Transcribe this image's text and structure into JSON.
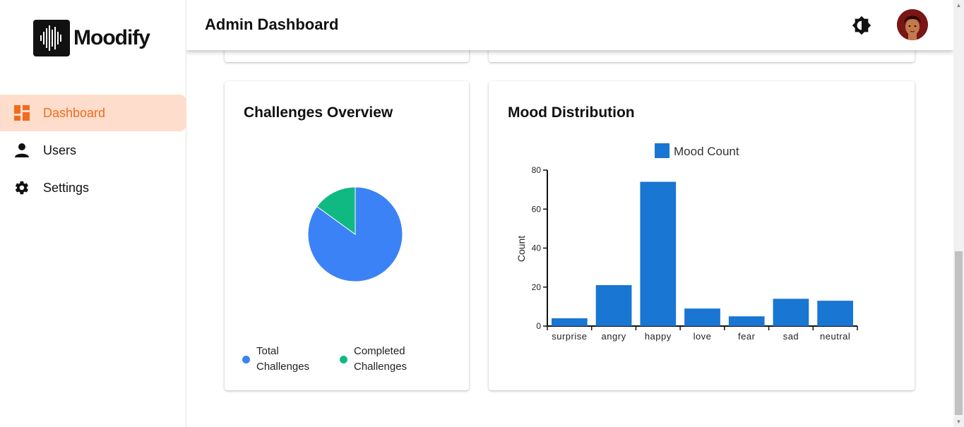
{
  "app": {
    "name": "Moodify"
  },
  "sidebar": {
    "items": [
      {
        "label": "Dashboard",
        "icon": "dashboard-icon",
        "active": true
      },
      {
        "label": "Users",
        "icon": "person-icon",
        "active": false
      },
      {
        "label": "Settings",
        "icon": "gear-icon",
        "active": false
      }
    ]
  },
  "header": {
    "title": "Admin Dashboard",
    "theme_icon": "brightness-icon",
    "avatar_icon": "user-avatar"
  },
  "colors": {
    "accent": "#f26b1d",
    "active_bg": "#ffddcc",
    "blue": "#3b82f6",
    "green": "#10b981",
    "bar": "#1976d2"
  },
  "challenges": {
    "title": "Challenges Overview",
    "legend": [
      {
        "label": "Total Challenges",
        "color": "#3b82f6"
      },
      {
        "label": "Completed Challenges",
        "color": "#10b981"
      }
    ]
  },
  "mood": {
    "title": "Mood Distribution"
  },
  "chart_data": [
    {
      "type": "pie",
      "categories": [
        "Total Challenges",
        "Completed Challenges"
      ],
      "values": [
        85,
        15
      ],
      "colors": [
        "#3b82f6",
        "#10b981"
      ]
    },
    {
      "type": "bar",
      "categories": [
        "surprise",
        "angry",
        "happy",
        "love",
        "fear",
        "sad",
        "neutral"
      ],
      "series": [
        {
          "name": "Mood Count",
          "values": [
            4,
            21,
            74,
            9,
            5,
            14,
            13
          ],
          "color": "#1976d2"
        }
      ],
      "ylabel": "Count",
      "xlabel": "",
      "ylim": [
        0,
        80
      ],
      "yticks": [
        0,
        20,
        40,
        60,
        80
      ],
      "legend_position": "top",
      "grid": false
    }
  ]
}
